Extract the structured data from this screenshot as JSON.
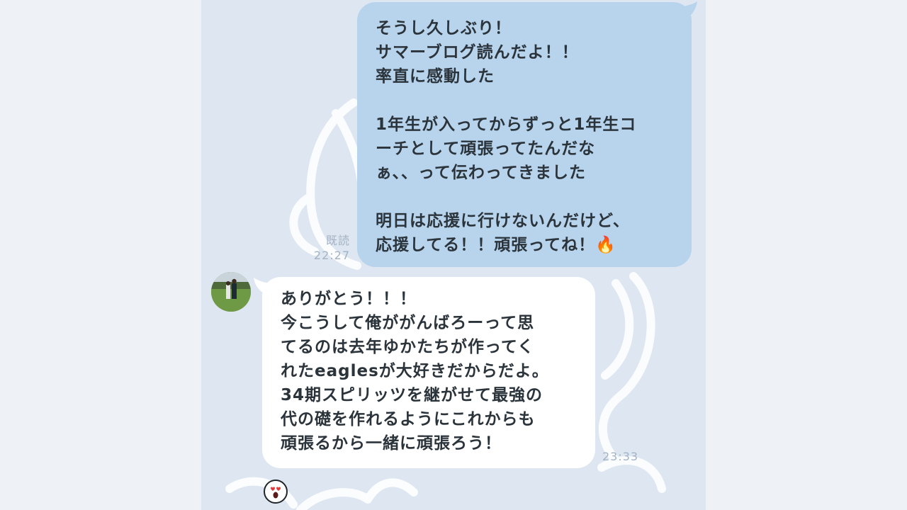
{
  "conversation": {
    "outgoing": {
      "text": "そうし久しぶり！\nサマーブログ読んだよ！！\n率直に感動した\n\n1年生が入ってからずっと1年生コ\nーチとして頑張ってたんだな\nぁ、、って伝わってきました\n\n明日は応援に行けないんだけど、\n応援してる！！頑張ってね！🔥",
      "read_label": "既読",
      "time": "22:27"
    },
    "incoming": {
      "text": "ありがとう！！！\n今こうして俺ががんばろーって思\nてるのは去年ゆかたちが作ってく\nれたeaglesが大好きだからだよ。\n34期スピリッツを継がせて最強の\n代の礎を作れるようにこれからも\n頑張るから一緒に頑張ろう！",
      "time": "23:33",
      "avatar": "sender-photo",
      "reaction_icon": "heart-eyes-face"
    }
  },
  "theme": {
    "outgoing_bubble": "#b7d4ec",
    "incoming_bubble": "#ffffff",
    "chat_background": "#dde6f1"
  }
}
